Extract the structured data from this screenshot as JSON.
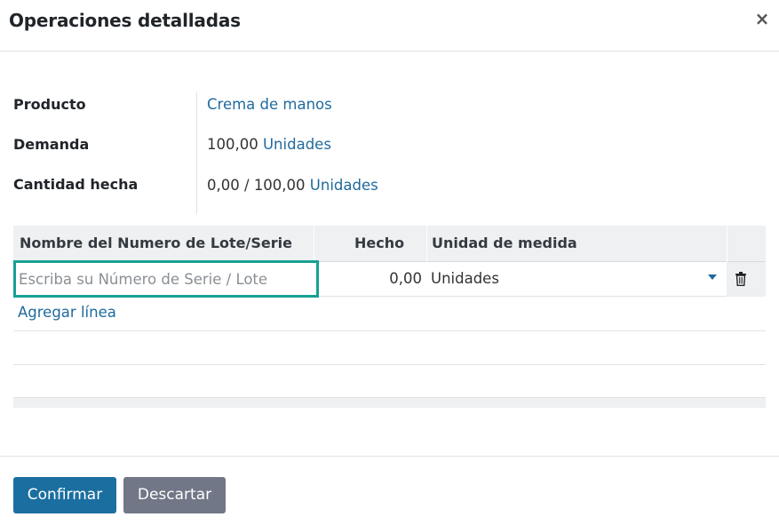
{
  "dialog": {
    "title": "Operaciones detalladas",
    "close_symbol": "×"
  },
  "fields": {
    "product": {
      "label": "Producto",
      "value": "Crema de manos"
    },
    "demand": {
      "label": "Demanda",
      "quantity": "100,00",
      "uom": "Unidades"
    },
    "done": {
      "label": "Cantidad hecha",
      "quantity": "0,00",
      "separator": "/",
      "total": "100,00",
      "uom": "Unidades"
    }
  },
  "table": {
    "columns": [
      "Nombre del Numero de Lote/Serie",
      "Hecho",
      "Unidad de medida"
    ],
    "rows": [
      {
        "lot_placeholder": "Escriba su Número de Serie / Lote",
        "lot_value": "",
        "done": "0,00",
        "uom": "Unidades"
      }
    ],
    "add_line": "Agregar línea",
    "row_icon": "trash-icon",
    "dropdown_icon": "caret-down-icon"
  },
  "footer": {
    "confirm": "Confirmar",
    "discard": "Descartar"
  },
  "colors": {
    "link": "#1f6a9c",
    "primary": "#1a6fa0",
    "secondary": "#717786",
    "focus_border": "#17a094",
    "header_bg": "#eef0f2"
  }
}
